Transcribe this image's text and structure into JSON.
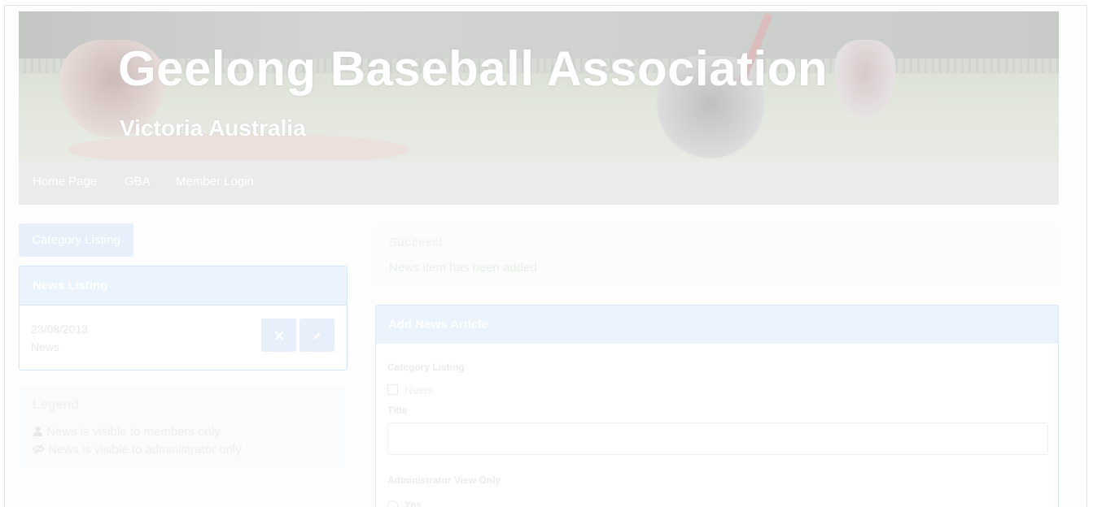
{
  "header": {
    "title": "Geelong Baseball Association",
    "subtitle": "Victoria Australia"
  },
  "nav": {
    "items": [
      "Home Page",
      "GBA",
      "Member Login"
    ]
  },
  "sidebar": {
    "category_button": "Category Listing",
    "news_listing": {
      "heading": "News Listing",
      "items": [
        {
          "date": "23/08/2013",
          "category": "News",
          "delete_icon": "times-icon",
          "edit_icon": "pencil-icon"
        }
      ]
    },
    "legend": {
      "title": "Legend",
      "members_only": "News is visible to members only",
      "admin_only": "News is visible to administrator only",
      "members_icon": "user-icon",
      "admin_icon": "eye-slash-icon"
    }
  },
  "alert": {
    "title": "Success!",
    "message": "News item has been added"
  },
  "form": {
    "heading": "Add News Article",
    "category_label": "Category Listing",
    "category_options": [
      "News"
    ],
    "title_label": "Title",
    "title_value": "",
    "admin_view_label": "Administrator View Only",
    "admin_view_option": "Yes"
  },
  "colors": {
    "accent": "#ebf3fd",
    "navbar": "#ebebeb",
    "button": "#e6effa"
  }
}
